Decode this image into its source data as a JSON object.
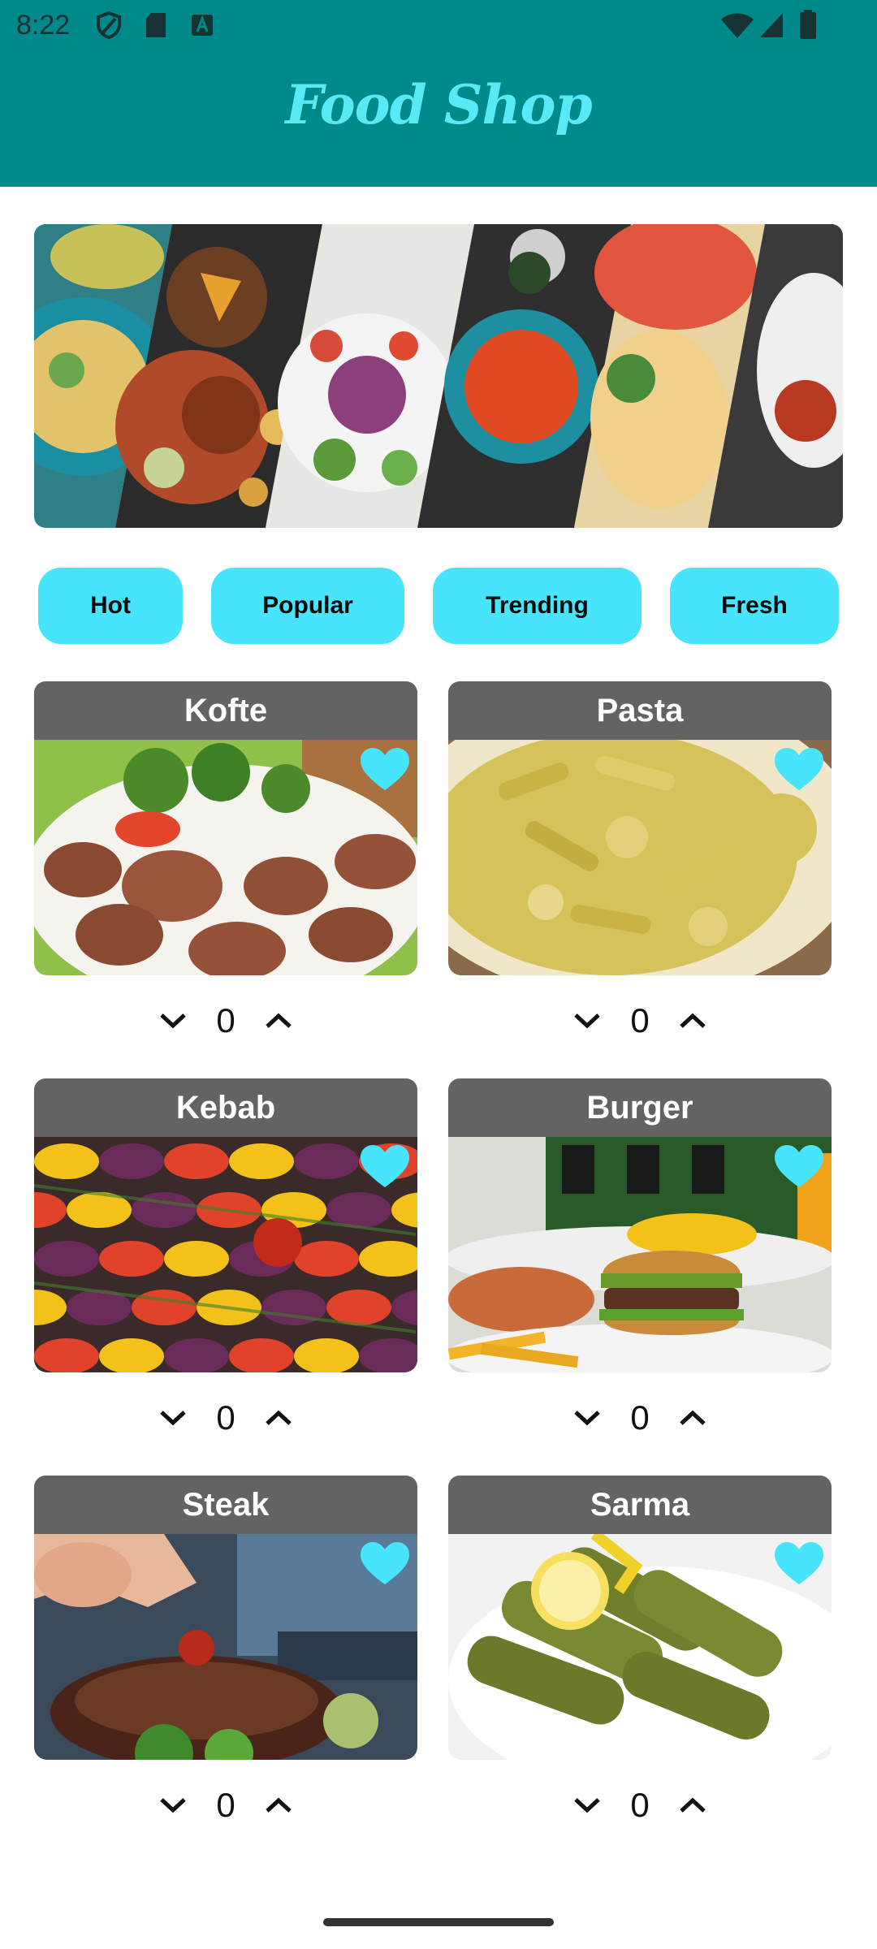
{
  "status_bar": {
    "time": "8:22"
  },
  "app_bar": {
    "title": "Food Shop"
  },
  "colors": {
    "app_bar_bg": "#00898a",
    "title": "#57eaf5",
    "chip_bg": "#48e4fb",
    "card_header": "#636363",
    "heart": "#48e4fb"
  },
  "banner": {
    "icon": "food-collage-image"
  },
  "categories": [
    {
      "label": "Hot"
    },
    {
      "label": "Popular"
    },
    {
      "label": "Trending"
    },
    {
      "label": "Fresh"
    }
  ],
  "foods": [
    {
      "name": "Kofte",
      "quantity": "0",
      "favorite": true
    },
    {
      "name": "Pasta",
      "quantity": "0",
      "favorite": true
    },
    {
      "name": "Kebab",
      "quantity": "0",
      "favorite": true
    },
    {
      "name": "Burger",
      "quantity": "0",
      "favorite": true
    },
    {
      "name": "Steak",
      "quantity": "0",
      "favorite": true
    },
    {
      "name": "Sarma",
      "quantity": "0",
      "favorite": true
    }
  ]
}
